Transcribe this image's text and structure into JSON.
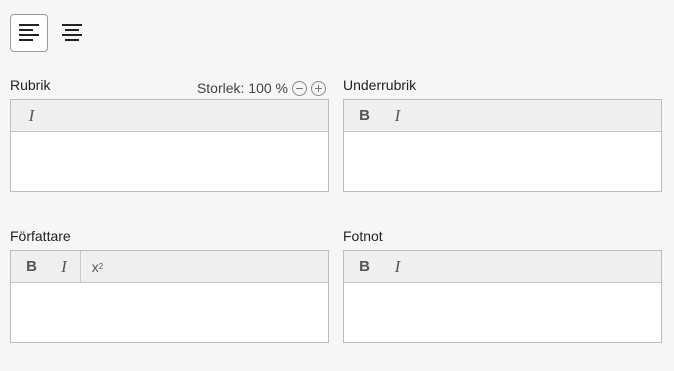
{
  "alignment": {
    "left_icon": "align-left-icon",
    "center_icon": "align-center-icon",
    "selected": "left"
  },
  "rubrik": {
    "label": "Rubrik",
    "size_label": "Storlek: 100 %",
    "toolbar": [
      "italic"
    ]
  },
  "underrubrik": {
    "label": "Underrubrik",
    "toolbar": [
      "bold",
      "italic"
    ]
  },
  "forfattare": {
    "label": "Författare",
    "toolbar": [
      "bold",
      "italic",
      "superscript"
    ]
  },
  "fotnot": {
    "label": "Fotnot",
    "toolbar": [
      "bold",
      "italic"
    ]
  },
  "buttons": {
    "bold": "B",
    "italic": "I",
    "superscript": "x",
    "superscript_mark": "2"
  }
}
